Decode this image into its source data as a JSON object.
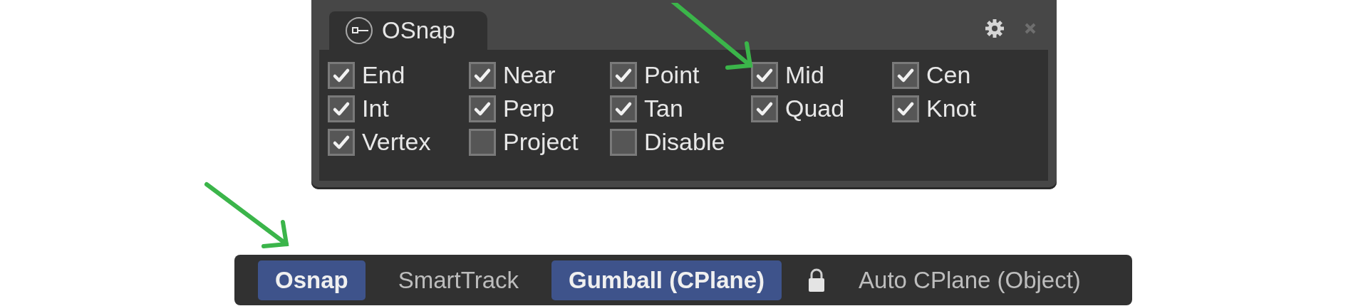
{
  "panel": {
    "tab_title": "OSnap",
    "options": [
      {
        "label": "End",
        "checked": true
      },
      {
        "label": "Near",
        "checked": true
      },
      {
        "label": "Point",
        "checked": true
      },
      {
        "label": "Mid",
        "checked": true
      },
      {
        "label": "Cen",
        "checked": true
      },
      {
        "label": "Int",
        "checked": true
      },
      {
        "label": "Perp",
        "checked": true
      },
      {
        "label": "Tan",
        "checked": true
      },
      {
        "label": "Quad",
        "checked": true
      },
      {
        "label": "Knot",
        "checked": true
      },
      {
        "label": "Vertex",
        "checked": true
      },
      {
        "label": "Project",
        "checked": false
      },
      {
        "label": "Disable",
        "checked": false
      }
    ]
  },
  "status_bar": {
    "items": [
      {
        "label": "Osnap",
        "selected": true,
        "locked": false
      },
      {
        "label": "SmartTrack",
        "selected": false,
        "locked": false
      },
      {
        "label": "Gumball (CPlane)",
        "selected": true,
        "locked": false
      },
      {
        "label": "Auto CPlane (Object)",
        "selected": false,
        "locked": true
      }
    ]
  }
}
